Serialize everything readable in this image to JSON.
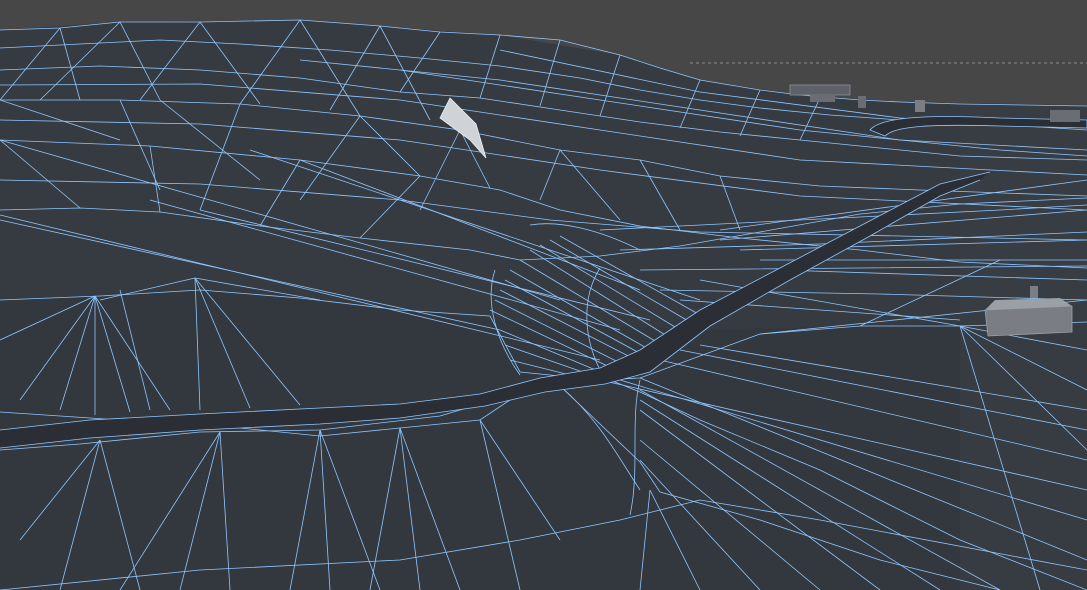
{
  "viewport": {
    "mode": "wireframe-on-shaded",
    "colors": {
      "background": "#4a4a4a",
      "terrain_surface": "#363b42",
      "wireframe": "#8fc6ff",
      "road": "#2b2f35",
      "selected_face": "#cfd3d8",
      "building": "#7a7e84"
    }
  }
}
